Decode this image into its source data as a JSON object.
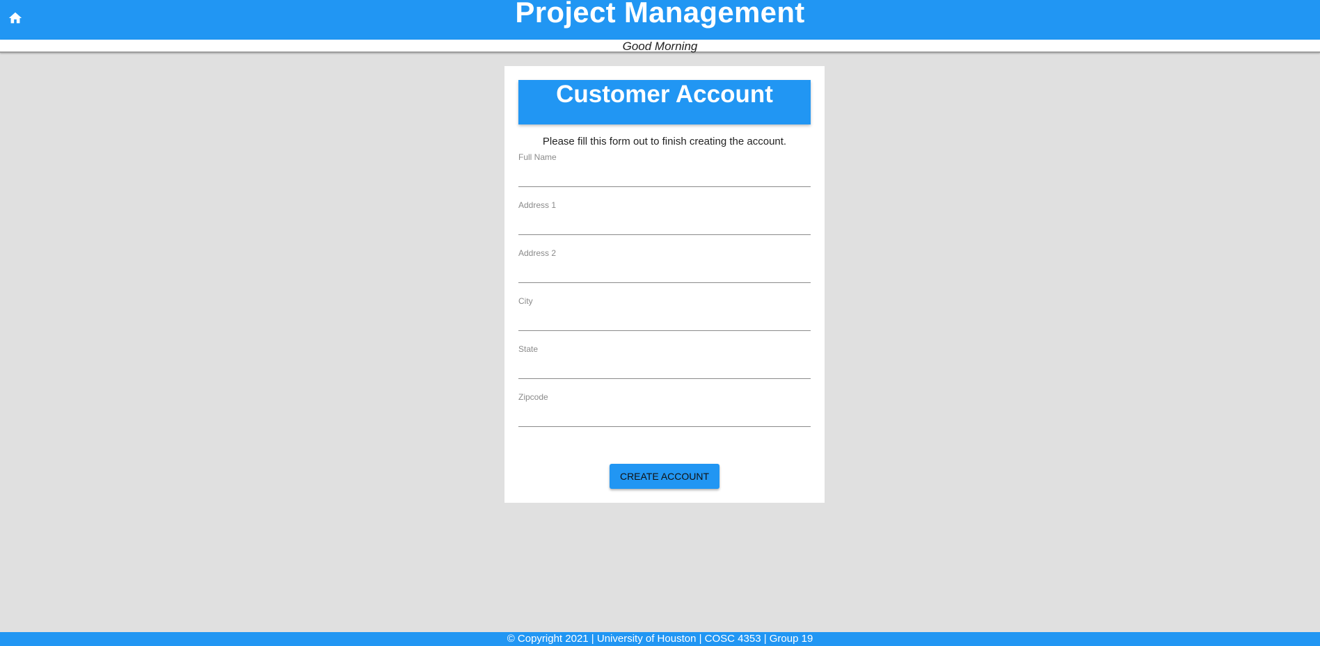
{
  "header": {
    "title": "Project Management",
    "home_icon": "home-icon",
    "background_color": "#2196f3"
  },
  "greeting": {
    "text": "Good Morning"
  },
  "card": {
    "title": "Customer Account",
    "instructions": "Please fill this form out to finish creating the account.",
    "fields": [
      {
        "label": "Full Name",
        "value": ""
      },
      {
        "label": "Address 1",
        "value": ""
      },
      {
        "label": "Address 2",
        "value": ""
      },
      {
        "label": "City",
        "value": ""
      },
      {
        "label": "State",
        "value": ""
      },
      {
        "label": "Zipcode",
        "value": ""
      }
    ],
    "submit_label": "CREATE ACCOUNT"
  },
  "footer": {
    "text": "© Copyright 2021 | University of Houston | COSC 4353 | Group 19"
  }
}
